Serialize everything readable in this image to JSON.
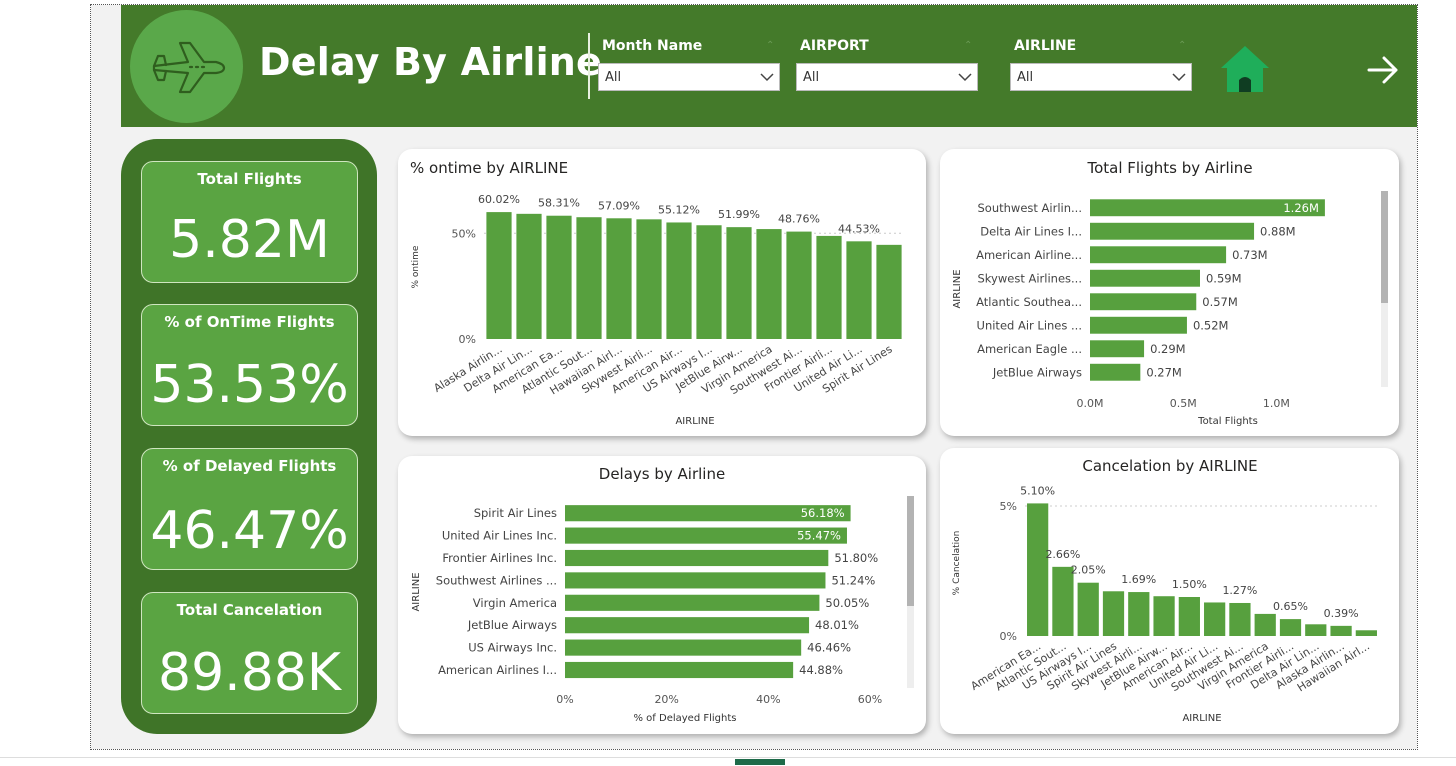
{
  "header": {
    "title": "Delay By Airline",
    "slicers": [
      {
        "label": "Month Name",
        "value": "All"
      },
      {
        "label": "AIRPORT",
        "value": "All"
      },
      {
        "label": "AIRLINE",
        "value": "All"
      }
    ]
  },
  "colors": {
    "header_bg": "#447a2a",
    "accent": "#5aa442",
    "bar": "#57a03e",
    "kpi_panel": "#3f7428"
  },
  "icons": {
    "logo": "airplane-icon",
    "home": "home-icon",
    "next": "arrow-right-icon"
  },
  "kpis": [
    {
      "title": "Total Flights",
      "value": "5.82M"
    },
    {
      "title": "% of OnTime Flights",
      "value": "53.53%"
    },
    {
      "title": "% of Delayed Flights",
      "value": "46.47%"
    },
    {
      "title": "Total Cancelation",
      "value": "89.88K"
    }
  ],
  "chart_data": [
    {
      "id": "ontime",
      "type": "bar",
      "title": "% ontime by AIRLINE",
      "xlabel": "AIRLINE",
      "ylabel": "% ontime",
      "ylim": [
        0,
        70
      ],
      "yticks": [
        "0%",
        "50%"
      ],
      "categories": [
        "Alaska Airlin...",
        "Delta Air Lin...",
        "American Ea...",
        "Atlantic Sout...",
        "Hawaiian Airl...",
        "Skywest Airli...",
        "American Air...",
        "US Airways I...",
        "JetBlue Airw...",
        "Virgin America",
        "Southwest Ai...",
        "Frontier Airli...",
        "United Air Li...",
        "Spirit Air Lines"
      ],
      "values": [
        60.02,
        59.2,
        58.31,
        57.6,
        57.09,
        56.6,
        55.12,
        53.8,
        52.9,
        51.99,
        50.8,
        48.76,
        46.2,
        44.53
      ],
      "data_labels": [
        "60.02%",
        "",
        "58.31%",
        "",
        "57.09%",
        "",
        "55.12%",
        "",
        "51.99%",
        "",
        "48.76%",
        "",
        "44.53%",
        ""
      ]
    },
    {
      "id": "total_flights",
      "type": "bar",
      "orientation": "horizontal",
      "title": "Total Flights by Airline",
      "xlabel": "Total Flights",
      "ylabel": "AIRLINE",
      "xlim": [
        0,
        1.4
      ],
      "xticks": [
        "0.0M",
        "0.5M",
        "1.0M"
      ],
      "categories": [
        "Southwest Airlin...",
        "Delta Air Lines I...",
        "American Airline...",
        "Skywest Airlines...",
        "Atlantic Southea...",
        "United Air Lines ...",
        "American Eagle ...",
        "JetBlue Airways"
      ],
      "values": [
        1.26,
        0.88,
        0.73,
        0.59,
        0.57,
        0.52,
        0.29,
        0.27
      ],
      "data_labels": [
        "1.26M",
        "0.88M",
        "0.73M",
        "0.59M",
        "0.57M",
        "0.52M",
        "0.29M",
        "0.27M"
      ]
    },
    {
      "id": "delays",
      "type": "bar",
      "orientation": "horizontal",
      "title": "Delays by Airline",
      "xlabel": "% of Delayed Flights",
      "ylabel": "AIRLINE",
      "xlim": [
        0,
        60
      ],
      "xticks": [
        "0%",
        "20%",
        "40%",
        "60%"
      ],
      "categories": [
        "Spirit Air Lines",
        "United Air Lines Inc.",
        "Frontier Airlines Inc.",
        "Southwest Airlines ...",
        "Virgin America",
        "JetBlue Airways",
        "US Airways Inc.",
        "American Airlines I..."
      ],
      "values": [
        56.18,
        55.47,
        51.8,
        51.24,
        50.05,
        48.01,
        46.46,
        44.88
      ],
      "data_labels": [
        "56.18%",
        "55.47%",
        "51.80%",
        "51.24%",
        "50.05%",
        "48.01%",
        "46.46%",
        "44.88%"
      ]
    },
    {
      "id": "cancel",
      "type": "bar",
      "title": "Cancelation by AIRLINE",
      "xlabel": "AIRLINE",
      "ylabel": "% Cancelation",
      "ylim": [
        0,
        6
      ],
      "yticks": [
        "0%",
        "5%"
      ],
      "categories": [
        "American Ea...",
        "Atlantic Sout...",
        "US Airways I...",
        "Spirit Air Lines",
        "Skywest Airli...",
        "JetBlue Airw...",
        "American Air...",
        "United Air Li...",
        "Southwest Ai...",
        "Virgin America",
        "Frontier Airli...",
        "Delta Air Lin...",
        "Alaska Airlin...",
        "Hawaiian Airl..."
      ],
      "values": [
        5.1,
        2.66,
        2.05,
        1.72,
        1.69,
        1.53,
        1.5,
        1.29,
        1.27,
        0.85,
        0.65,
        0.45,
        0.39,
        0.22
      ],
      "data_labels": [
        "5.10%",
        "2.66%",
        "2.05%",
        "",
        "1.69%",
        "",
        "1.50%",
        "",
        "1.27%",
        "",
        "0.65%",
        "",
        "0.39%",
        ""
      ]
    }
  ]
}
